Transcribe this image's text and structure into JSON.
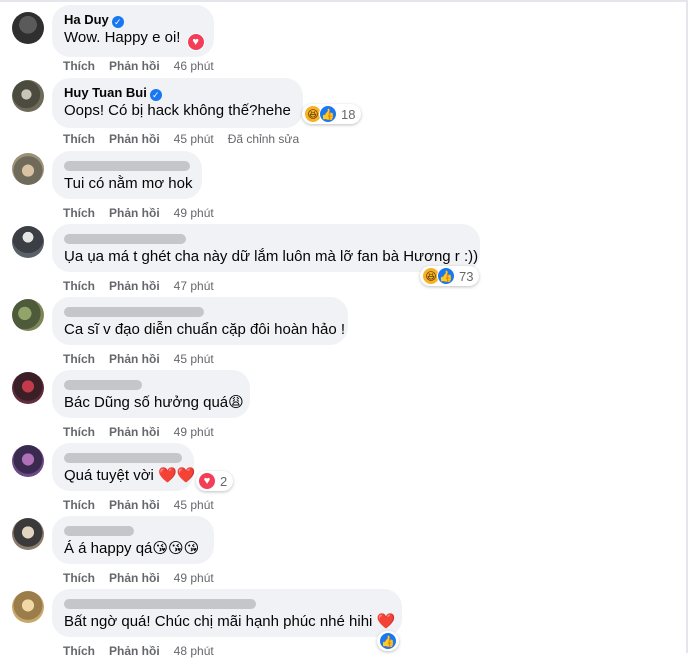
{
  "comments": [
    {
      "name": "Ha Duy",
      "verified": true,
      "text": "Wow. Happy e oi!",
      "time": "46 phút",
      "react_count": "",
      "icons": [
        "love"
      ]
    },
    {
      "name": "Huy Tuan Bui",
      "verified": true,
      "text": "Oops! Có bị hack không thế?hehe",
      "time": "45 phút",
      "edited": "Đã chỉnh sửa",
      "react_count": "18",
      "icons": [
        "haha",
        "like"
      ]
    },
    {
      "name": "",
      "text": "Tui có nằm mơ hok",
      "time": "49 phút"
    },
    {
      "name": "",
      "text": "Ụa ụa má t ghét cha này dữ lắm luôn mà lỡ fan bà Hương r :))",
      "time": "47 phút",
      "react_count": "73",
      "icons": [
        "haha",
        "like"
      ]
    },
    {
      "name": "",
      "text": "Ca sĩ v đạo diễn chuẩn cặp đôi hoàn hảo !",
      "time": "45 phút"
    },
    {
      "name": "",
      "text": "Bác Dũng số hưởng quá😩",
      "time": "49 phút"
    },
    {
      "name": "",
      "text": "Quá tuyệt vời ❤️❤️",
      "time": "45 phút",
      "react_count": "2",
      "icons": [
        "love"
      ]
    },
    {
      "name": "",
      "text": "Á á happy qá😘😘😘",
      "time": "49 phút"
    },
    {
      "name": "",
      "text": "Bất ngờ quá! Chúc chị mãi hạnh phúc nhé hihi ❤️",
      "time": "48 phút",
      "icons": [
        "like"
      ]
    }
  ],
  "labels": {
    "like": "Thích",
    "reply": "Phản hồi"
  },
  "icons": {
    "verified": "✓",
    "love": "♥",
    "haha": "😆",
    "like": "👍"
  }
}
